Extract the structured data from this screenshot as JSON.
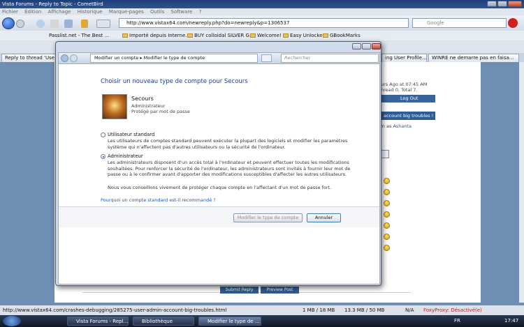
{
  "window": {
    "title": "Vista Forums - Reply to Topic - CometBird"
  },
  "menu": [
    "Fichier",
    "Édition",
    "Affichage",
    "Historique",
    "Marque-pages",
    "Outils",
    "Software",
    "?"
  ],
  "address": {
    "url": "http://www.vistax64.com/newreply.php?do=newreply&p=1306537"
  },
  "search": {
    "placeholder": "Google"
  },
  "bookmarks": [
    "Passlist.net - The Best ...",
    "Importé depuis Interne...",
    "BUY colloidal SILVER G...",
    "Welcome!",
    "Easy Unlocker",
    "GBookMarks"
  ],
  "tabs": [
    {
      "label": "Reply to thread 'Use"
    },
    {
      "label": "ing User Profile..."
    },
    {
      "label": "WINRE ne demarre pas en faisa..."
    }
  ],
  "page": {
    "time_text": "urs Ago at 07:45 AM",
    "unread_text": "nread 0, Total 7.",
    "logout": "Log Out",
    "thread_title": "account big troubles !",
    "login_prefix": "in as",
    "login_user": "Ashanta",
    "submit_label": "Submit Reply",
    "preview_label": "Preview Post"
  },
  "dialog": {
    "breadcrumb_root": "Modifier un compte",
    "breadcrumb_current": "Modifier le type de compte",
    "search_placeholder": "Rechercher",
    "heading": "Choisir un nouveau type de compte pour Secours",
    "account": {
      "name": "Secours",
      "type": "Administrateur",
      "protection": "Protégé par mot de passe"
    },
    "options": [
      {
        "label": "Utilisateur standard",
        "selected": false,
        "desc": [
          "Les utilisateurs de comptes standard peuvent exécuter la plupart des logiciels et modifier les paramètres",
          "système qui n'affectent pas d'autres utilisateurs ou la sécurité de l'ordinateur."
        ]
      },
      {
        "label": "Administrateur",
        "selected": true,
        "desc": [
          "Les administrateurs disposent d'un accès total à l'ordinateur et peuvent effectuer toutes les modifications",
          "souhaitées. Pour renforcer la sécurité de l'ordinateur, les administrateurs sont invités à fournir leur mot de",
          "passe ou à le confirmer avant d'apporter des modifications susceptibles d'affecter les autres utilisateurs."
        ]
      }
    ],
    "advice": "Nous vous conseillons vivement de protéger chaque compte en l'affectant d'un mot de passe fort.",
    "link": "Pourquoi un compte standard est-il recommandé ?",
    "confirm_label": "Modifier le type de compte",
    "cancel_label": "Annuler"
  },
  "status": {
    "url": "http://www.vistax64.com/crashes-debugging/285275-user-admin-account-big-troubles.html",
    "stat1": "1 MB / 18 MB",
    "stat2": "13.3 MB / 50 MB",
    "na": "N/A",
    "foxy": "FoxyProxy: Désactivé(e)"
  },
  "taskbar": {
    "items": [
      "Vista Forums - Repl...",
      "Bibliothèque",
      "Modifier le type de ..."
    ],
    "lang": "FR",
    "clock": "17:47"
  },
  "colors": {
    "link": "#1c5ab5",
    "heading": "#1f3f8a",
    "foxy": "#c02020"
  }
}
